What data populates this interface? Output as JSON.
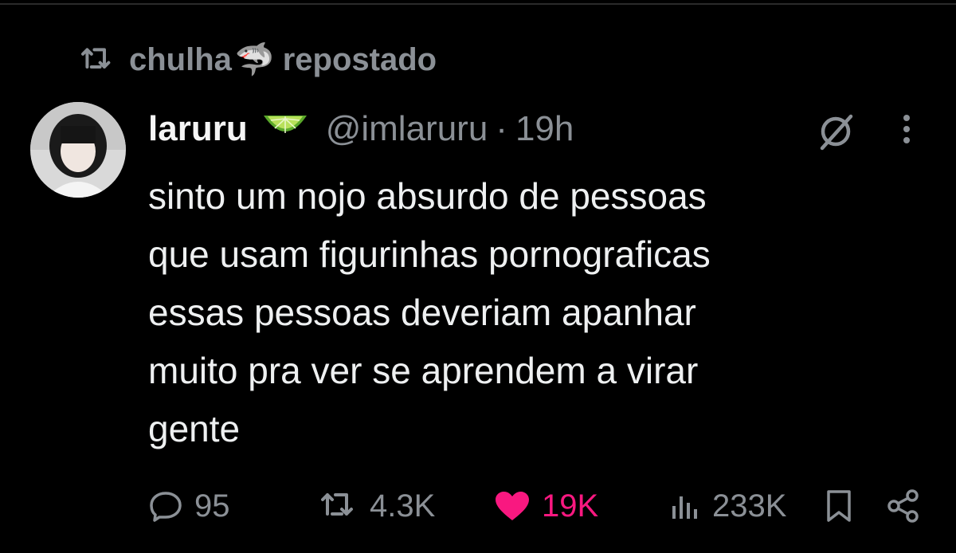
{
  "repost": {
    "user": "chulha",
    "emoji": "🦈",
    "label": "repostado"
  },
  "author": {
    "display_name": "laruru",
    "badge_emoji": "lime-icon",
    "handle": "@imlaruru",
    "separator": "·",
    "time": "19h"
  },
  "tweet": {
    "lines": [
      "sinto um nojo absurdo de pessoas",
      "que usam figurinhas pornograficas",
      "essas pessoas deveriam apanhar",
      "muito pra ver se aprendem a virar",
      "gente"
    ]
  },
  "actions": {
    "replies": "95",
    "reposts": "4.3K",
    "likes": "19K",
    "views": "233K"
  },
  "colors": {
    "background": "#000000",
    "text": "#e7e9ea",
    "muted": "#8b9096",
    "like": "#f91880"
  }
}
